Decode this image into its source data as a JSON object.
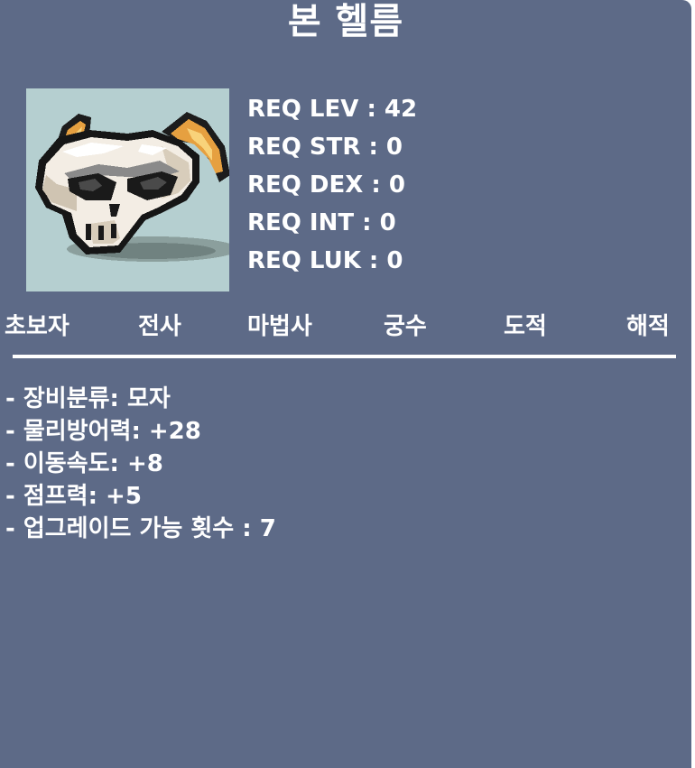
{
  "item": {
    "name": "본 헬름",
    "icon": "bone-helm-icon"
  },
  "requirements": [
    "REQ LEV : 42",
    "REQ STR : 0",
    "REQ DEX : 0",
    "REQ INT : 0",
    "REQ LUK : 0"
  ],
  "jobs": [
    "초보자",
    "전사",
    "마법사",
    "궁수",
    "도적",
    "해적"
  ],
  "stats": [
    "- 장비분류: 모자",
    "- 물리방어력: +28",
    "- 이동속도: +8",
    "- 점프력: +5",
    "- 업그레이드 가능 횟수 : 7"
  ],
  "colors": {
    "panel": "#5d6a87",
    "icon_background": "#b5cfd0",
    "text": "#ffffff"
  }
}
